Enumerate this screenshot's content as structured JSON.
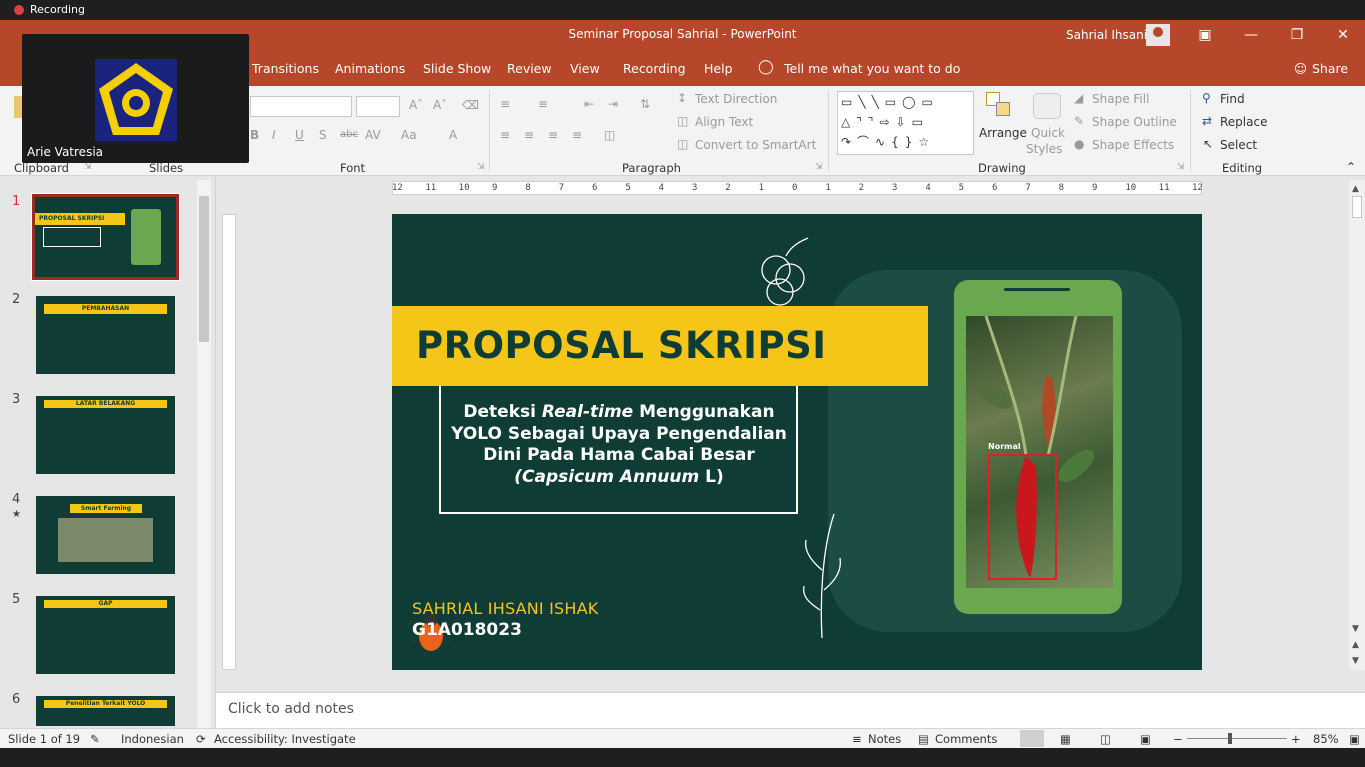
{
  "recording_indicator": "Recording",
  "window": {
    "doc_title": "Seminar Proposal Sahrial  -  PowerPoint",
    "user_name": "Sahrial Ihsani"
  },
  "tabs": [
    "Transitions",
    "Animations",
    "Slide Show",
    "Review",
    "View",
    "Recording",
    "Help"
  ],
  "tell_me": "Tell me what you want to do",
  "share": "Share",
  "ribbon": {
    "groups": {
      "clipboard": "Clipboard",
      "slides": "Slides",
      "font": "Font",
      "paragraph": "Paragraph",
      "drawing": "Drawing",
      "editing": "Editing"
    },
    "paragraph": {
      "text_direction": "Text Direction",
      "align_text": "Align Text",
      "convert_smartart": "Convert to SmartArt"
    },
    "drawing": {
      "arrange": "Arrange",
      "quick_styles_1": "Quick",
      "quick_styles_2": "Styles",
      "shape_fill": "Shape Fill",
      "shape_outline": "Shape Outline",
      "shape_effects": "Shape Effects"
    },
    "editing": {
      "find": "Find",
      "replace": "Replace",
      "select": "Select"
    }
  },
  "video_overlay": {
    "participant": "Arie Vatresia"
  },
  "ruler_labels": [
    "12",
    "11",
    "10",
    "9",
    "8",
    "7",
    "6",
    "5",
    "4",
    "3",
    "2",
    "1",
    "0",
    "1",
    "2",
    "3",
    "4",
    "5",
    "6",
    "7",
    "8",
    "9",
    "10",
    "11",
    "12"
  ],
  "thumbnails": [
    {
      "num": "1",
      "title": "PROPOSAL SKRIPSI"
    },
    {
      "num": "2",
      "title": "PEMBAHASAN"
    },
    {
      "num": "3",
      "title": "LATAR BELAKANG"
    },
    {
      "num": "4",
      "title": "Smart Farming"
    },
    {
      "num": "5",
      "title": "GAP"
    },
    {
      "num": "6",
      "title": "Penelitian Terkait YOLO"
    }
  ],
  "slide": {
    "title": "PROPOSAL SKRIPSI",
    "subtitle_1": "Deteksi ",
    "subtitle_italic_1": "Real-time",
    "subtitle_2": " Menggunakan YOLO Sebagai Upaya Pengendalian Dini Pada Hama Cabai Besar ",
    "subtitle_italic_2": "(Capsicum Annuum",
    "subtitle_3": " L)",
    "author": "SAHRIAL IHSANI ISHAK",
    "nim": "G1A018023",
    "detection_label": "Normal"
  },
  "notes_placeholder": "Click to add notes",
  "status": {
    "slide_info": "Slide 1 of 19",
    "language": "Indonesian",
    "accessibility": "Accessibility: Investigate",
    "notes": "Notes",
    "comments": "Comments",
    "zoom": "85%"
  },
  "colors": {
    "accent": "#b7472a",
    "slide_bg": "#0f3d35",
    "slide_yellow": "#f5c518"
  }
}
